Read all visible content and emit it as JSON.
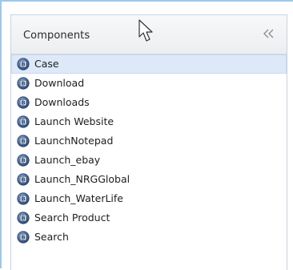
{
  "panel": {
    "title": "Components",
    "collapse_icon": "double-chevron-left-icon",
    "accent_color": "#9cc8ea",
    "selected_color": "#dde9f8"
  },
  "list": {
    "item_icon": "business-component-icon",
    "items": [
      {
        "label": "Case",
        "selected": true
      },
      {
        "label": "Download",
        "selected": false
      },
      {
        "label": "Downloads",
        "selected": false
      },
      {
        "label": "Launch Website",
        "selected": false
      },
      {
        "label": "LaunchNotepad",
        "selected": false
      },
      {
        "label": "Launch_ebay",
        "selected": false
      },
      {
        "label": "Launch_NRGGlobal",
        "selected": false
      },
      {
        "label": "Launch_WaterLife",
        "selected": false
      },
      {
        "label": "Search Product",
        "selected": false
      },
      {
        "label": "Search",
        "selected": false
      }
    ]
  }
}
